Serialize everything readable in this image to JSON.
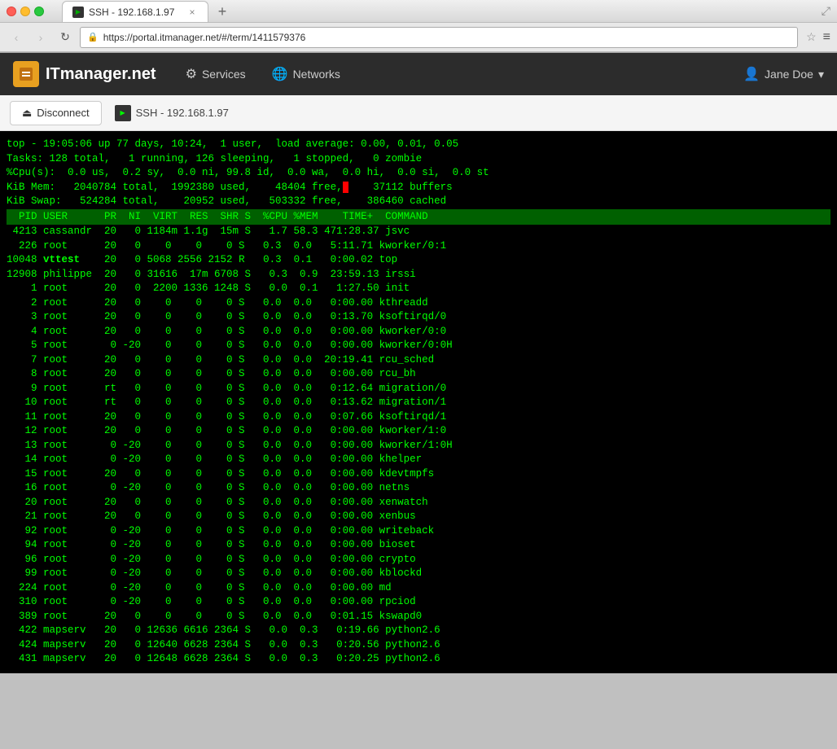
{
  "browser": {
    "tab_title": "SSH - 192.168.1.97",
    "url": "https://portal.itmanager.net/#/term/1411579376",
    "close_label": "×",
    "new_tab_label": "+"
  },
  "nav_buttons": {
    "back": "‹",
    "forward": "›",
    "refresh": "↻"
  },
  "header": {
    "logo_text": "ITmanager.net",
    "services_label": "Services",
    "networks_label": "Networks",
    "user_label": "Jane Doe",
    "user_dropdown": "▾"
  },
  "toolbar": {
    "disconnect_label": "Disconnect",
    "ssh_label": "SSH - 192.168.1.97"
  },
  "terminal": {
    "lines": [
      "top - 19:05:06 up 77 days, 10:24,  1 user,  load average: 0.00, 0.01, 0.05",
      "Tasks: 128 total,   1 running, 126 sleeping,   1 stopped,   0 zombie",
      "%Cpu(s):  0.0 us,  0.2 sy,  0.0 ni, 99.8 id,  0.0 wa,  0.0 hi,  0.0 si,  0.0 st",
      "KiB Mem:   2040784 total,  1992380 used,    48404 free,     37112 buffers",
      "KiB Swap:   524284 total,    20952 used,   503332 free,    386460 cached",
      "",
      "  PID USER      PR  NI  VIRT  RES  SHR S  %CPU %MEM    TIME+  COMMAND",
      " 4213 cassandr  20   0 1184m 1.1g  15m S   1.7 58.3 471:28.37 jsvc",
      "  226 root      20   0    0    0    0 S   0.3  0.0   5:11.71 kworker/0:1",
      "10048 vttest    20   0 5068 2556 2152 R   0.3  0.1   0:00.02 top",
      "12908 philippe  20   0 31616  17m 6708 S   0.3  0.9  23:59.13 irssi",
      "    1 root      20   0  2200 1336 1248 S   0.0  0.1   1:27.50 init",
      "    2 root      20   0    0    0    0 S   0.0  0.0   0:00.00 kthreadd",
      "    3 root      20   0    0    0    0 S   0.0  0.0   0:13.70 ksoftirqd/0",
      "    4 root      20   0    0    0    0 S   0.0  0.0   0:00.00 kworker/0:0",
      "    5 root       0 -20    0    0    0 S   0.0  0.0   0:00.00 kworker/0:0H",
      "    7 root      20   0    0    0    0 S   0.0  0.0  20:19.41 rcu_sched",
      "    8 root      20   0    0    0    0 S   0.0  0.0   0:00.00 rcu_bh",
      "    9 root      rt   0    0    0    0 S   0.0  0.0   0:12.64 migration/0",
      "   10 root      rt   0    0    0    0 S   0.0  0.0   0:13.62 migration/1",
      "   11 root      20   0    0    0    0 S   0.0  0.0   0:07.66 ksoftirqd/1",
      "   12 root      20   0    0    0    0 S   0.0  0.0   0:00.00 kworker/1:0",
      "   13 root       0 -20    0    0    0 S   0.0  0.0   0:00.00 kworker/1:0H",
      "   14 root       0 -20    0    0    0 S   0.0  0.0   0:00.00 khelper",
      "   15 root      20   0    0    0    0 S   0.0  0.0   0:00.00 kdevtmpfs",
      "   16 root       0 -20    0    0    0 S   0.0  0.0   0:00.00 netns",
      "   20 root      20   0    0    0    0 S   0.0  0.0   0:00.00 xenwatch",
      "   21 root      20   0    0    0    0 S   0.0  0.0   0:00.00 xenbus",
      "   92 root       0 -20    0    0    0 S   0.0  0.0   0:00.00 writeback",
      "   94 root       0 -20    0    0    0 S   0.0  0.0   0:00.00 bioset",
      "   96 root       0 -20    0    0    0 S   0.0  0.0   0:00.00 crypto",
      "   99 root       0 -20    0    0    0 S   0.0  0.0   0:00.00 kblockd",
      "  224 root       0 -20    0    0    0 S   0.0  0.0   0:00.00 md",
      "  310 root       0 -20    0    0    0 S   0.0  0.0   0:00.00 rpciod",
      "  389 root      20   0    0    0    0 S   0.0  0.0   0:01.15 kswapd0",
      "  422 mapserv   20   0 12636 6616 2364 S   0.0  0.3   0:19.66 python2.6",
      "  424 mapserv   20   0 12640 6628 2364 S   0.0  0.3   0:20.56 python2.6",
      "  431 mapserv   20   0 12648 6628 2364 S   0.0  0.3   0:20.25 python2.6"
    ],
    "header_line_index": 6
  }
}
